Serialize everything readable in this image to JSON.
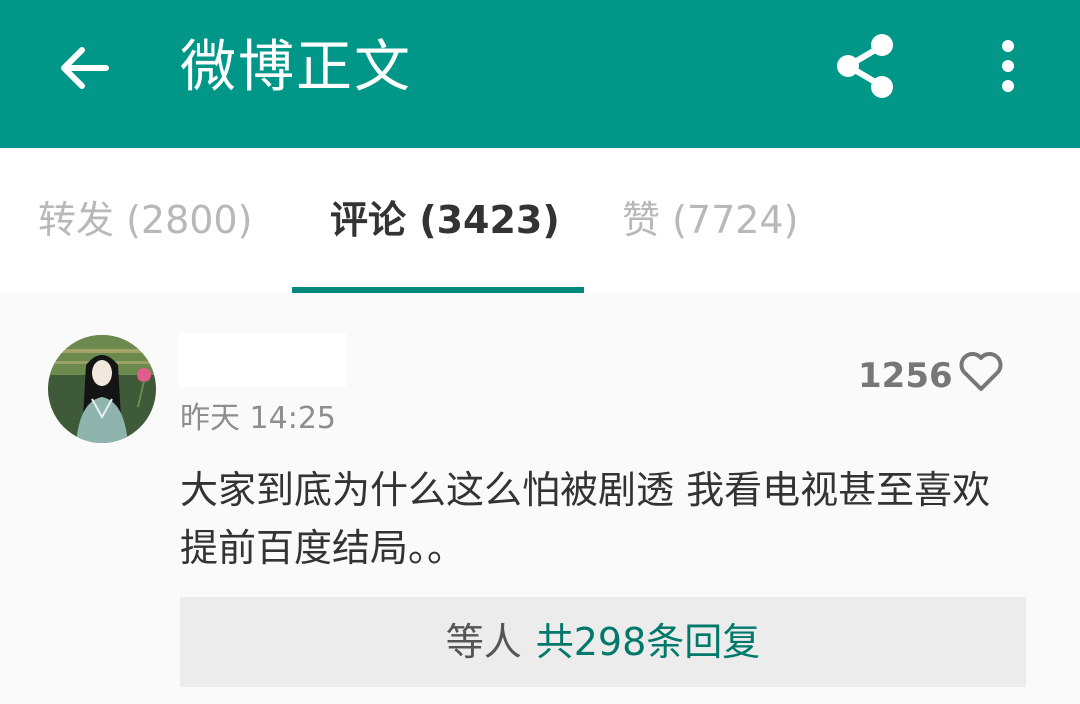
{
  "appbar": {
    "title": "微博正文",
    "icons": [
      "back-arrow-icon",
      "share-icon",
      "more-vert-icon"
    ],
    "color": "#009688"
  },
  "tabs": [
    {
      "label": "转发 (2800)",
      "active": false
    },
    {
      "label": "评论 (3423)",
      "active": true
    },
    {
      "label": "赞 (7724)",
      "active": false
    }
  ],
  "comment": {
    "time": "昨天 14:25",
    "likes": "1256",
    "text": "大家到底为什么这么怕被剧透 我看电视甚至喜欢提前百度结局。。",
    "reply_users": "等人",
    "reply_count": "共298条回复"
  },
  "colors": {
    "accent": "#009688",
    "indicator": "#00897b",
    "reply_link": "#00796b"
  }
}
